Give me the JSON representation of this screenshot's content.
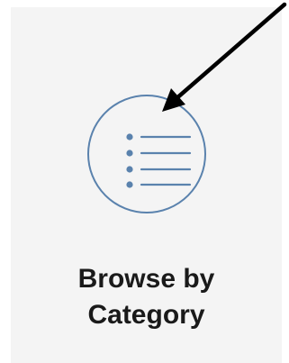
{
  "card": {
    "label_line1": "Browse by",
    "label_line2": "Category",
    "icon": "list-icon"
  },
  "colors": {
    "card_background": "#f4f4f4",
    "icon_stroke": "#5a82ad",
    "label_text": "#1a1a1a",
    "annotation_arrow": "#000000"
  },
  "annotation": {
    "type": "arrow",
    "points_to": "list-icon"
  }
}
